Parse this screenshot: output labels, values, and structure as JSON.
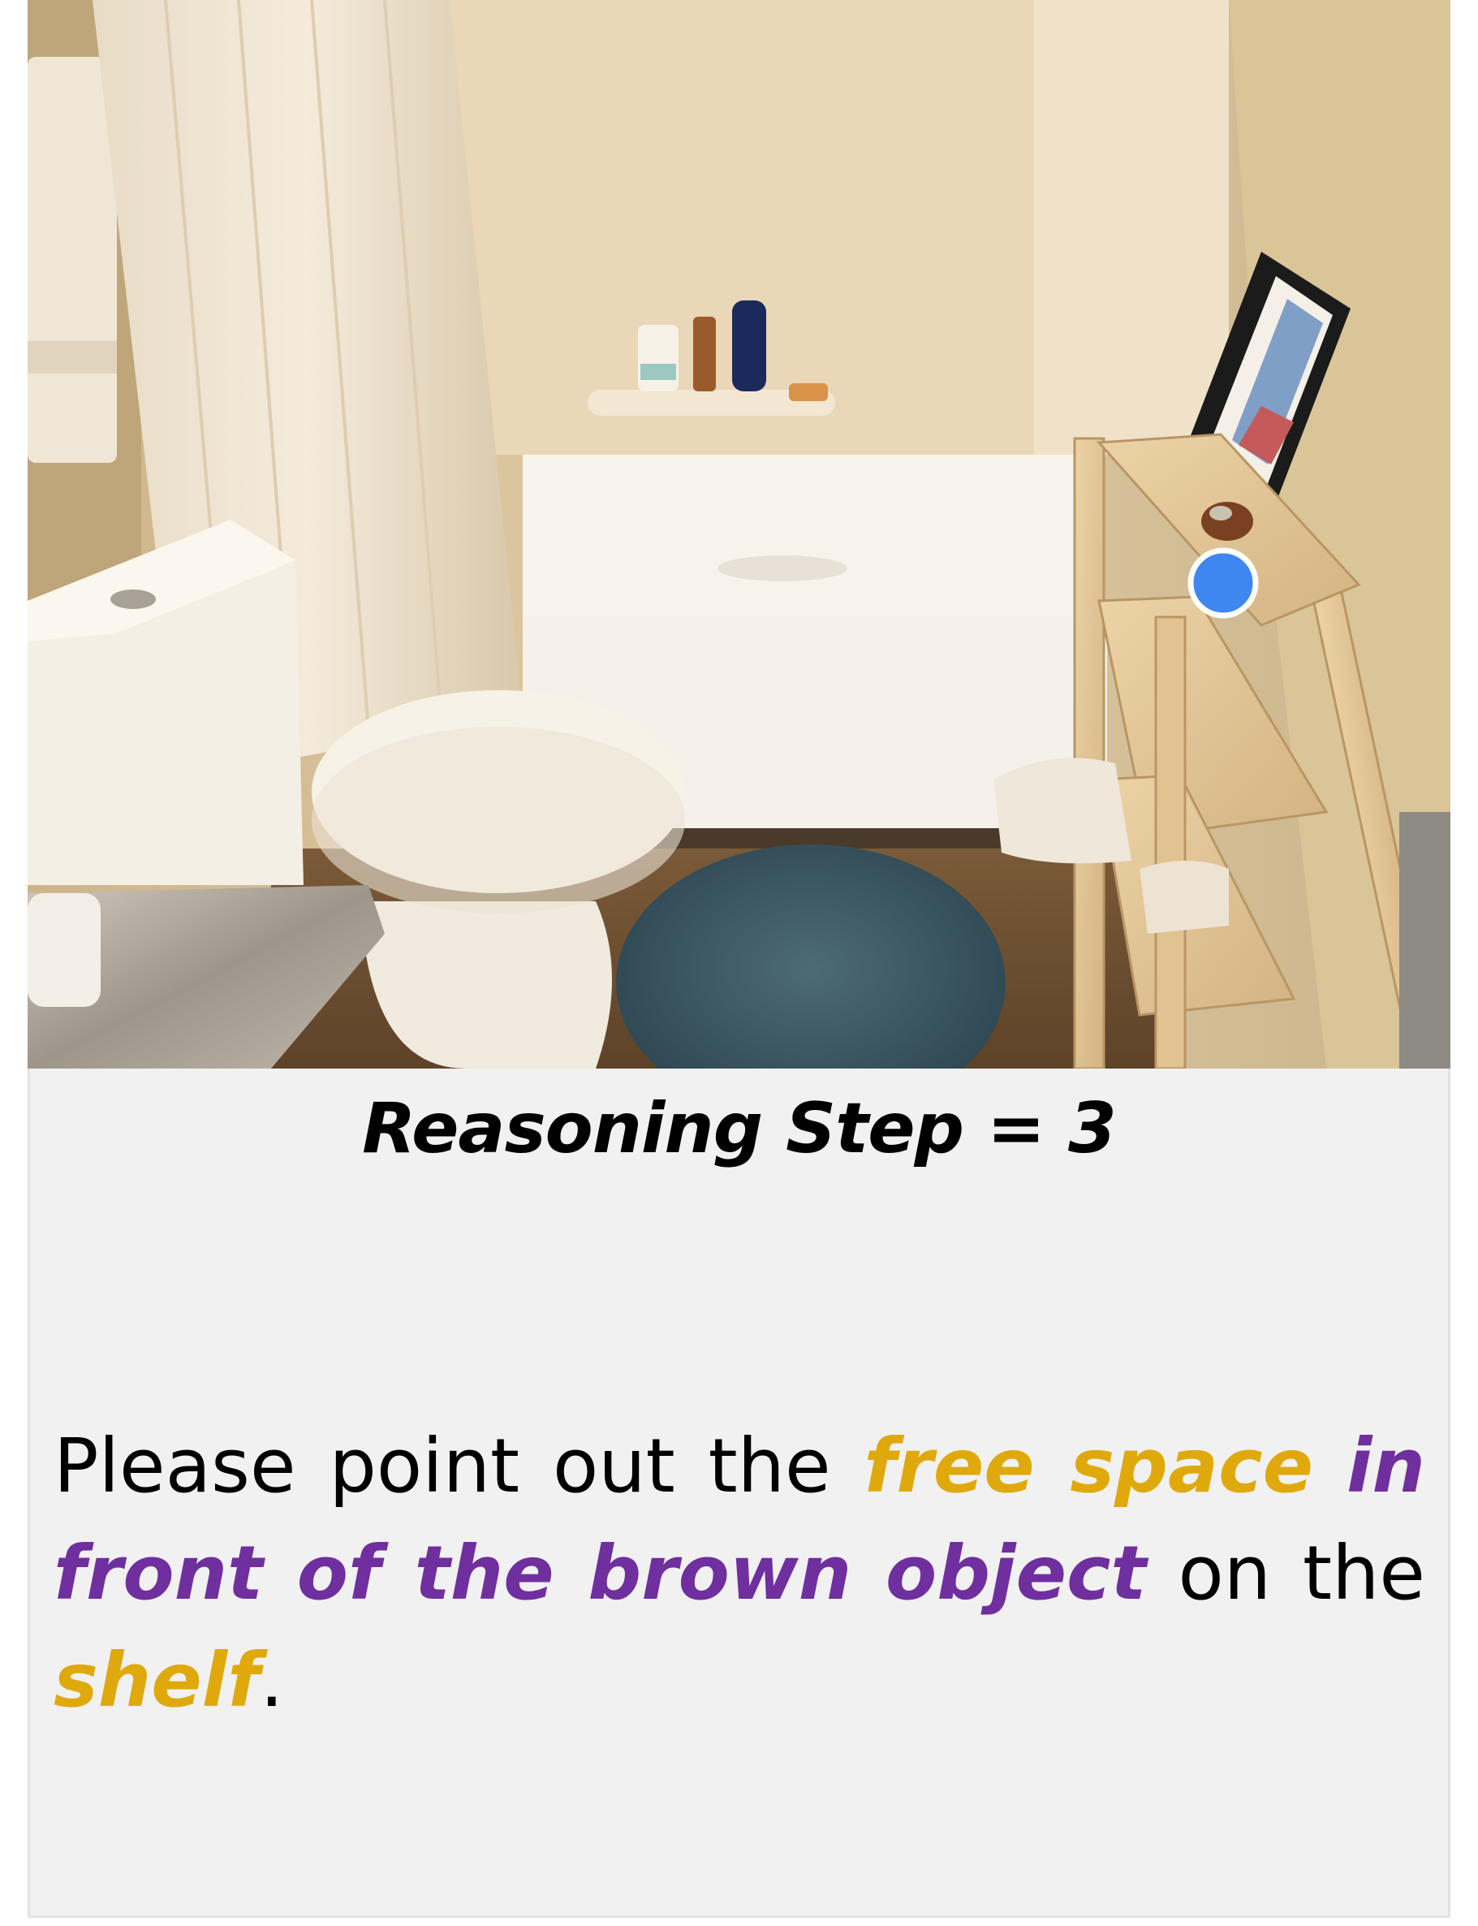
{
  "panel": {
    "title": "Reasoning Step = 3",
    "instruction": {
      "part1": "Please point out the ",
      "highlight_target": "free space",
      "space1": " ",
      "highlight_reference": "in front of the brown object",
      "part2": " on the ",
      "highlight_surface": "shelf",
      "part3": "."
    }
  },
  "colors": {
    "marker": "#3f87f0",
    "highlight_yellow": "#dfa90c",
    "highlight_purple": "#6f2f9f",
    "panel_background": "#f1f1f1"
  },
  "marker": {
    "shape": "circle",
    "icon": "point-marker-icon"
  }
}
